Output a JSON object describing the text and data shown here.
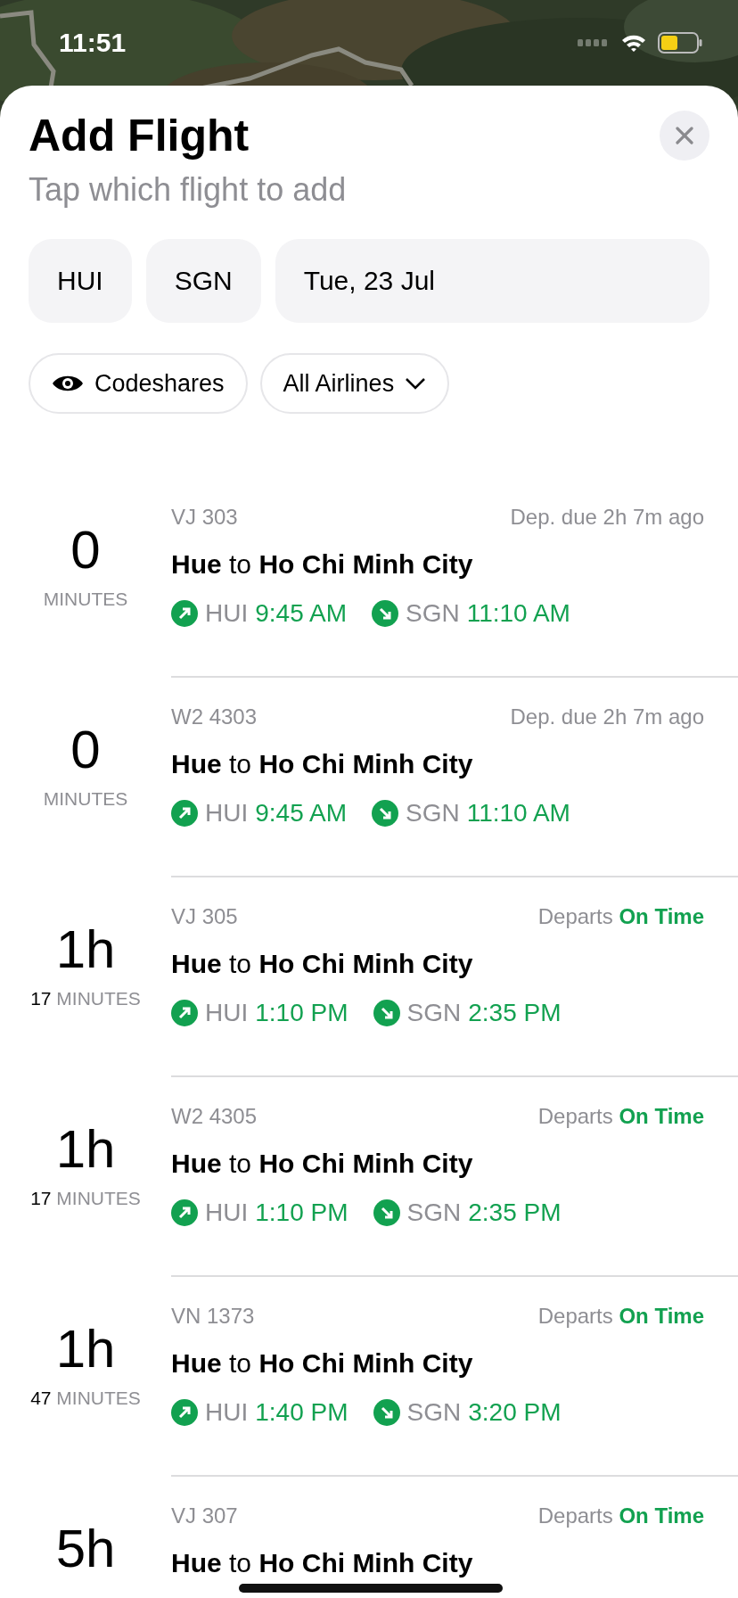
{
  "status_bar": {
    "time": "11:51"
  },
  "sheet": {
    "title": "Add Flight",
    "subtitle": "Tap which flight to add"
  },
  "search": {
    "from": "HUI",
    "to": "SGN",
    "date": "Tue, 23 Jul"
  },
  "filters": {
    "codeshares": "Codeshares",
    "airlines": "All Airlines"
  },
  "flights": [
    {
      "duration": {
        "main": "0",
        "unit": "MINUTES"
      },
      "code": "VJ 303",
      "status": {
        "label": "Dep. due 2h 7m ago"
      },
      "route": "**Hue** to **Ho Chi Minh City**",
      "dep": {
        "airport": "HUI",
        "time": "9:45 AM"
      },
      "arr": {
        "airport": "SGN",
        "time": "11:10 AM"
      }
    },
    {
      "duration": {
        "main": "0",
        "unit": "MINUTES"
      },
      "code": "W2 4303",
      "status": {
        "label": "Dep. due 2h 7m ago"
      },
      "route": "**Hue** to **Ho Chi Minh City**",
      "dep": {
        "airport": "HUI",
        "time": "9:45 AM"
      },
      "arr": {
        "airport": "SGN",
        "time": "11:10 AM"
      }
    },
    {
      "duration": {
        "main": "1h",
        "minutes": "17",
        "unit": "MINUTES"
      },
      "code": "VJ 305",
      "status": {
        "label": "Departs",
        "value": "On Time"
      },
      "route": "**Hue** to **Ho Chi Minh City**",
      "dep": {
        "airport": "HUI",
        "time": "1:10 PM"
      },
      "arr": {
        "airport": "SGN",
        "time": "2:35 PM"
      }
    },
    {
      "duration": {
        "main": "1h",
        "minutes": "17",
        "unit": "MINUTES"
      },
      "code": "W2 4305",
      "status": {
        "label": "Departs",
        "value": "On Time"
      },
      "route": "**Hue** to **Ho Chi Minh City**",
      "dep": {
        "airport": "HUI",
        "time": "1:10 PM"
      },
      "arr": {
        "airport": "SGN",
        "time": "2:35 PM"
      }
    },
    {
      "duration": {
        "main": "1h",
        "minutes": "47",
        "unit": "MINUTES"
      },
      "code": "VN 1373",
      "status": {
        "label": "Departs",
        "value": "On Time"
      },
      "route": "**Hue** to **Ho Chi Minh City**",
      "dep": {
        "airport": "HUI",
        "time": "1:40 PM"
      },
      "arr": {
        "airport": "SGN",
        "time": "3:20 PM"
      }
    },
    {
      "duration": {
        "main": "5h"
      },
      "code": "VJ 307",
      "status": {
        "label": "Departs",
        "value": "On Time"
      },
      "route": "**Hue** to **Ho Chi Minh City**"
    }
  ]
}
